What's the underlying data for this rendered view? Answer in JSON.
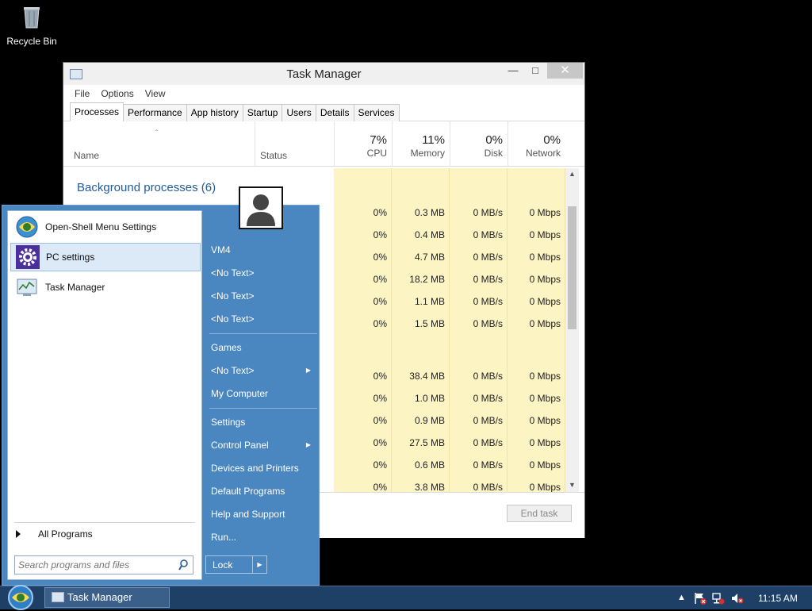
{
  "desktop": {
    "recycle_bin_label": "Recycle Bin"
  },
  "task_manager": {
    "title": "Task Manager",
    "menu": [
      "File",
      "Options",
      "View"
    ],
    "tabs": [
      "Processes",
      "Performance",
      "App history",
      "Startup",
      "Users",
      "Details",
      "Services"
    ],
    "active_tab": "Processes",
    "columns": {
      "name": "Name",
      "status": "Status",
      "cpu": {
        "pct": "7%",
        "label": "CPU"
      },
      "memory": {
        "pct": "11%",
        "label": "Memory"
      },
      "disk": {
        "pct": "0%",
        "label": "Disk"
      },
      "network": {
        "pct": "0%",
        "label": "Network"
      }
    },
    "group_label": "Background processes (6)",
    "rows": [
      {
        "cpu": "0%",
        "memory": "0.3 MB",
        "disk": "0 MB/s",
        "network": "0 Mbps"
      },
      {
        "cpu": "0%",
        "memory": "0.4 MB",
        "disk": "0 MB/s",
        "network": "0 Mbps"
      },
      {
        "cpu": "0%",
        "memory": "4.7 MB",
        "disk": "0 MB/s",
        "network": "0 Mbps"
      },
      {
        "cpu": "0%",
        "memory": "18.2 MB",
        "disk": "0 MB/s",
        "network": "0 Mbps"
      },
      {
        "cpu": "0%",
        "memory": "1.1 MB",
        "disk": "0 MB/s",
        "network": "0 Mbps"
      },
      {
        "cpu": "0%",
        "memory": "1.5 MB",
        "disk": "0 MB/s",
        "network": "0 Mbps"
      },
      {
        "cpu": "0%",
        "memory": "38.4 MB",
        "disk": "0 MB/s",
        "network": "0 Mbps"
      },
      {
        "cpu": "0%",
        "memory": "1.0 MB",
        "disk": "0 MB/s",
        "network": "0 Mbps"
      },
      {
        "cpu": "0%",
        "memory": "0.9 MB",
        "disk": "0 MB/s",
        "network": "0 Mbps"
      },
      {
        "cpu": "0%",
        "memory": "27.5 MB",
        "disk": "0 MB/s",
        "network": "0 Mbps"
      },
      {
        "cpu": "0%",
        "memory": "0.6 MB",
        "disk": "0 MB/s",
        "network": "0 Mbps"
      },
      {
        "cpu": "0%",
        "memory": "3.8 MB",
        "disk": "0 MB/s",
        "network": "0 Mbps"
      }
    ],
    "end_task_label": "End task",
    "colors": {
      "highlight": "#fdf4c4",
      "group": "#1f5b99"
    }
  },
  "start_menu": {
    "pinned": [
      {
        "label": "Open-Shell Menu Settings",
        "icon": "open-shell-icon"
      },
      {
        "label": "PC settings",
        "icon": "gear-icon",
        "selected": true
      },
      {
        "label": "Task Manager",
        "icon": "task-manager-icon"
      }
    ],
    "all_programs_label": "All Programs",
    "search_placeholder": "Search programs and files",
    "right_items": [
      {
        "label": "VM4"
      },
      {
        "label": "<No Text>"
      },
      {
        "label": "<No Text>"
      },
      {
        "label": "<No Text>"
      },
      {
        "label": "Games"
      },
      {
        "label": "<No Text>",
        "submenu": true
      },
      {
        "label": "My Computer"
      },
      {
        "label": "Settings"
      },
      {
        "label": "Control Panel",
        "submenu": true
      },
      {
        "label": "Devices and Printers"
      },
      {
        "label": "Default Programs"
      },
      {
        "label": "Help and Support"
      },
      {
        "label": "Run..."
      }
    ],
    "lock_label": "Lock",
    "colors": {
      "panel": "#4a86c0"
    }
  },
  "taskbar": {
    "task_button_label": "Task Manager",
    "clock": "11:15 AM",
    "tray_icons": [
      "chevron-up-icon",
      "action-center-flag-icon",
      "network-icon",
      "volume-muted-icon"
    ]
  }
}
